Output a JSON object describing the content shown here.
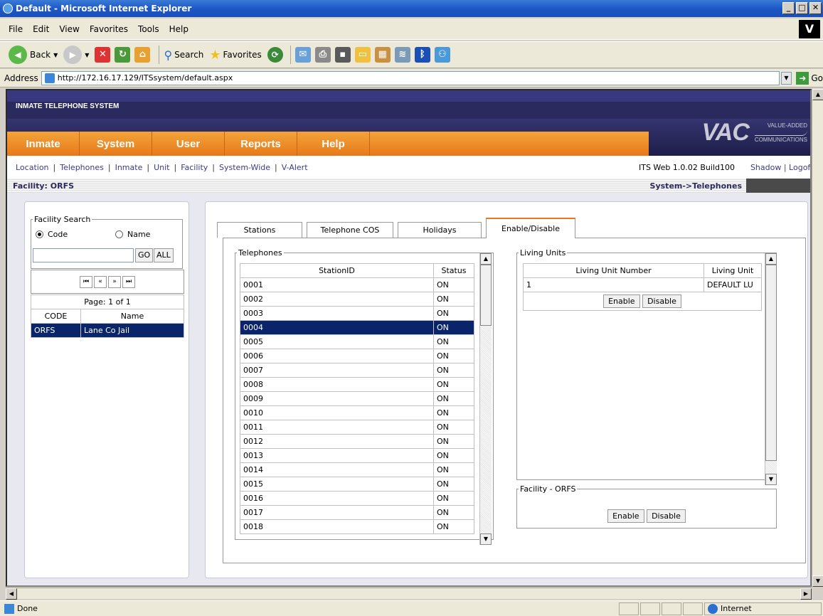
{
  "window": {
    "title": "Default - Microsoft Internet Explorer"
  },
  "menu": [
    "File",
    "Edit",
    "View",
    "Favorites",
    "Tools",
    "Help"
  ],
  "toolbar": {
    "back": "Back",
    "search": "Search",
    "favorites": "Favorites"
  },
  "address": {
    "label": "Address",
    "url": "http://172.16.17.129/ITSsystem/default.aspx",
    "go": "Go"
  },
  "status": {
    "text": "Done",
    "zone": "Internet"
  },
  "app": {
    "system_name": "INMATE TELEPHONE SYSTEM",
    "nav": [
      "Inmate",
      "System",
      "User",
      "Reports",
      "Help"
    ],
    "logo": {
      "big": "VAC",
      "line1": "VALUE-ADDED",
      "line2": "COMMUNICATIONS"
    },
    "subnav": [
      "Location",
      "Telephones",
      "Inmate",
      "Unit",
      "Facility",
      "System-Wide",
      "V-Alert"
    ],
    "build": "ITS Web 1.0.02 Build100",
    "user_links": "Shadow | Logoff",
    "facility": "Facility: ORFS",
    "breadcrumb": "System->Telephones"
  },
  "facility_search": {
    "legend": "Facility Search",
    "radio_code": "Code",
    "radio_name": "Name",
    "go": "GO",
    "all": "ALL",
    "page": "Page: 1 of 1",
    "headers": [
      "CODE",
      "Name"
    ],
    "rows": [
      {
        "code": "ORFS",
        "name": "Lane Co Jail"
      }
    ]
  },
  "tabs": [
    "Stations",
    "Telephone COS",
    "Holidays",
    "Enable/Disable"
  ],
  "telephones": {
    "legend": "Telephones",
    "headers": [
      "StationID",
      "Status"
    ],
    "rows": [
      {
        "id": "0001",
        "status": "ON"
      },
      {
        "id": "0002",
        "status": "ON"
      },
      {
        "id": "0003",
        "status": "ON"
      },
      {
        "id": "0004",
        "status": "ON"
      },
      {
        "id": "0005",
        "status": "ON"
      },
      {
        "id": "0006",
        "status": "ON"
      },
      {
        "id": "0007",
        "status": "ON"
      },
      {
        "id": "0008",
        "status": "ON"
      },
      {
        "id": "0009",
        "status": "ON"
      },
      {
        "id": "0010",
        "status": "ON"
      },
      {
        "id": "0011",
        "status": "ON"
      },
      {
        "id": "0012",
        "status": "ON"
      },
      {
        "id": "0013",
        "status": "ON"
      },
      {
        "id": "0014",
        "status": "ON"
      },
      {
        "id": "0015",
        "status": "ON"
      },
      {
        "id": "0016",
        "status": "ON"
      },
      {
        "id": "0017",
        "status": "ON"
      },
      {
        "id": "0018",
        "status": "ON"
      }
    ],
    "selected_index": 3
  },
  "living_units": {
    "legend": "Living Units",
    "headers": [
      "Living Unit Number",
      "Living Unit"
    ],
    "rows": [
      {
        "number": "1",
        "name": "DEFAULT LU"
      }
    ],
    "enable": "Enable",
    "disable": "Disable"
  },
  "facility_box": {
    "legend": "Facility - ORFS",
    "enable": "Enable",
    "disable": "Disable"
  },
  "colors": {
    "nav_orange": "#e6791a",
    "header_navy": "#2a2a5e",
    "selection": "#0a246a"
  }
}
